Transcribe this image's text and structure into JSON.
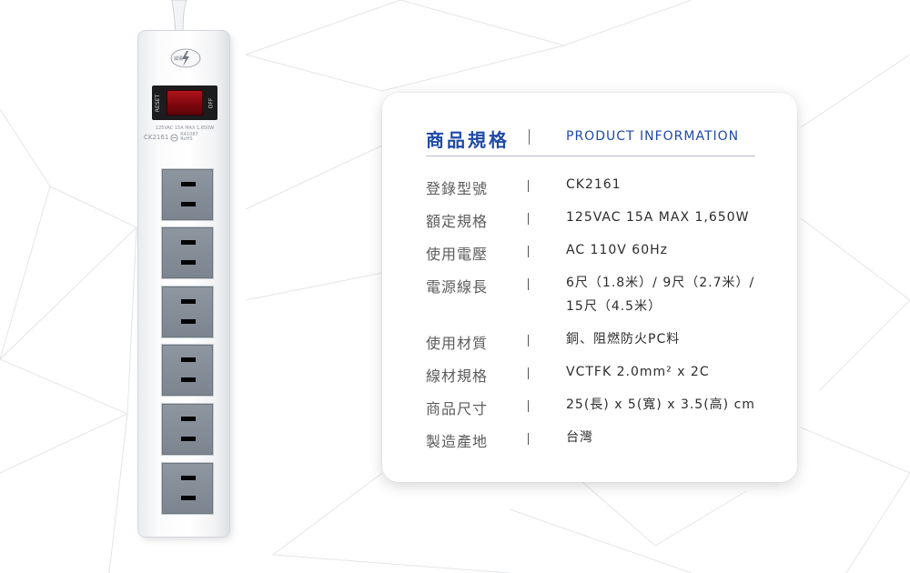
{
  "product": {
    "logo_text": "威電",
    "switch": {
      "left_label": "RESET",
      "right_label": "OFF"
    },
    "rating_line": "125VAC 15A MAX 1,650W",
    "model_line": "CK2161",
    "cert_lines": [
      "R41087",
      "RoHS"
    ],
    "outlet_count": 6
  },
  "card": {
    "title_cn": "商品規格",
    "title_en": "PRODUCT INFORMATION",
    "rows": [
      {
        "label": "登錄型號",
        "value": "CK2161"
      },
      {
        "label": "額定規格",
        "value": "125VAC 15A MAX 1,650W"
      },
      {
        "label": "使用電壓",
        "value": "AC 110V 60Hz"
      },
      {
        "label": "電源線長",
        "value": "6尺（1.8米）/ 9尺（2.7米）/ 15尺（4.5米）"
      },
      {
        "label": "使用材質",
        "value": "銅、阻燃防火PC料"
      },
      {
        "label": "線材規格",
        "value": "VCTFK 2.0mm² x 2C"
      },
      {
        "label": "商品尺寸",
        "value": "25(長) x 5(寬) x 3.5(高) cm"
      },
      {
        "label": "製造產地",
        "value": "台灣"
      }
    ]
  },
  "colors": {
    "accent_blue": "#1f4aa8",
    "label_gray": "#5c5c5c",
    "value_dark": "#2c2c2c",
    "switch_red": "#9a0d14",
    "outlet_gray": "#858d97"
  }
}
